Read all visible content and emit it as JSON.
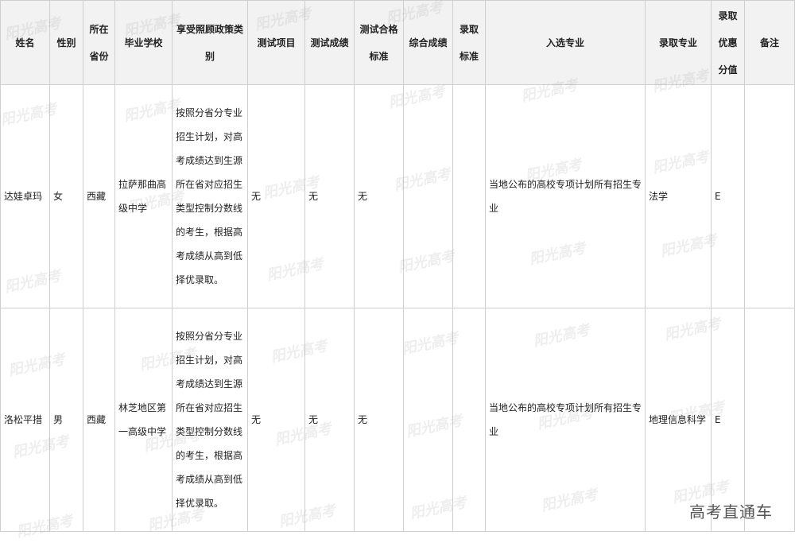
{
  "headers": {
    "name": "姓名",
    "gender": "性别",
    "province": "所在省份",
    "school": "毕业学校",
    "policy": "享受照顾政策类别",
    "test_item": "测试项目",
    "test_score": "测试成绩",
    "test_standard": "测试合格标准",
    "overall_score": "综合成绩",
    "admit_standard": "录取标准",
    "selected_major": "入选专业",
    "admitted_major": "录取专业",
    "bonus": "录取优惠分值",
    "remark": "备注"
  },
  "rows": [
    {
      "name": "达娃卓玛",
      "gender": "女",
      "province": "西藏",
      "school": "拉萨那曲高级中学",
      "policy": "按照分省分专业招生计划，对高考成绩达到生源所在省对应招生类型控制分数线的考生，根据高考成绩从高到低择优录取。",
      "test_item": "无",
      "test_score": "无",
      "test_standard": "无",
      "overall_score": "",
      "admit_standard": "",
      "selected_major": "当地公布的高校专项计划所有招生专业",
      "admitted_major": "法学",
      "bonus": "E",
      "remark": ""
    },
    {
      "name": "洛松平措",
      "gender": "男",
      "province": "西藏",
      "school": "林芝地区第一高级中学",
      "policy": "按照分省分专业招生计划，对高考成绩达到生源所在省对应招生类型控制分数线的考生，根据高考成绩从高到低择优录取。",
      "test_item": "无",
      "test_score": "无",
      "test_standard": "无",
      "overall_score": "",
      "admit_standard": "",
      "selected_major": "当地公布的高校专项计划所有招生专业",
      "admitted_major": "地理信息科学",
      "bonus": "E",
      "remark": ""
    }
  ],
  "watermark_text": "阳光高考",
  "brand_text": "高考直通车"
}
